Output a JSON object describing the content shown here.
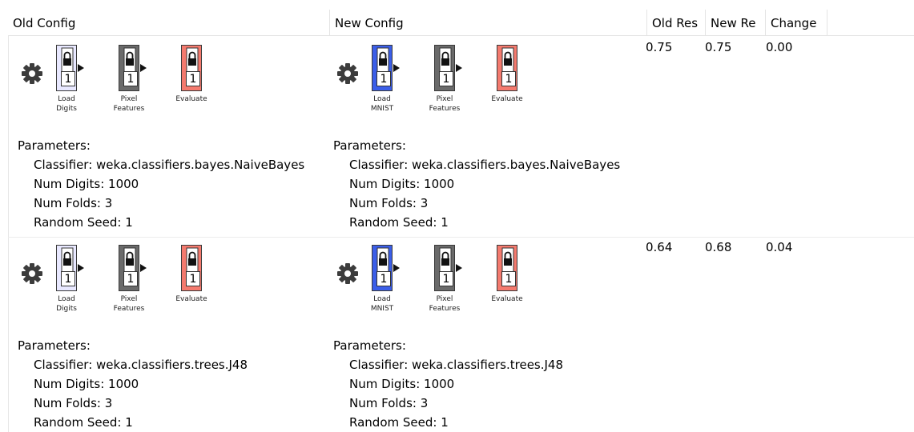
{
  "columns": {
    "old_config": "Old Config",
    "new_config": "New Config",
    "old_res": "Old Res",
    "new_res": "New Re",
    "change": "Change"
  },
  "colors": {
    "load_digits": "#e8e8ff",
    "load_mnist": "#3b5ee8",
    "pixel_features": "#6a6a6a",
    "evaluate": "#f47a6e"
  },
  "rows": [
    {
      "old": {
        "pipeline": [
          {
            "label1": "Load",
            "label2": "Digits",
            "num": "1"
          },
          {
            "label1": "Pixel",
            "label2": "Features",
            "num": "1"
          },
          {
            "label1": "Evaluate",
            "label2": "",
            "num": "1"
          }
        ],
        "params_title": "Parameters:",
        "params": [
          "Classifier: weka.classifiers.bayes.NaiveBayes",
          "Num Digits: 1000",
          "Num Folds: 3",
          "Random Seed: 1"
        ]
      },
      "new": {
        "pipeline": [
          {
            "label1": "Load",
            "label2": "MNIST",
            "num": "1"
          },
          {
            "label1": "Pixel",
            "label2": "Features",
            "num": "1"
          },
          {
            "label1": "Evaluate",
            "label2": "",
            "num": "1"
          }
        ],
        "params_title": "Parameters:",
        "params": [
          "Classifier: weka.classifiers.bayes.NaiveBayes",
          "Num Digits: 1000",
          "Num Folds: 3",
          "Random Seed: 1"
        ]
      },
      "old_res": "0.75",
      "new_res": "0.75",
      "change": "0.00"
    },
    {
      "old": {
        "pipeline": [
          {
            "label1": "Load",
            "label2": "Digits",
            "num": "1"
          },
          {
            "label1": "Pixel",
            "label2": "Features",
            "num": "1"
          },
          {
            "label1": "Evaluate",
            "label2": "",
            "num": "1"
          }
        ],
        "params_title": "Parameters:",
        "params": [
          "Classifier: weka.classifiers.trees.J48",
          "Num Digits: 1000",
          "Num Folds: 3",
          "Random Seed: 1"
        ]
      },
      "new": {
        "pipeline": [
          {
            "label1": "Load",
            "label2": "MNIST",
            "num": "1"
          },
          {
            "label1": "Pixel",
            "label2": "Features",
            "num": "1"
          },
          {
            "label1": "Evaluate",
            "label2": "",
            "num": "1"
          }
        ],
        "params_title": "Parameters:",
        "params": [
          "Classifier: weka.classifiers.trees.J48",
          "Num Digits: 1000",
          "Num Folds: 3",
          "Random Seed: 1"
        ]
      },
      "old_res": "0.64",
      "new_res": "0.68",
      "change": "0.04"
    }
  ]
}
